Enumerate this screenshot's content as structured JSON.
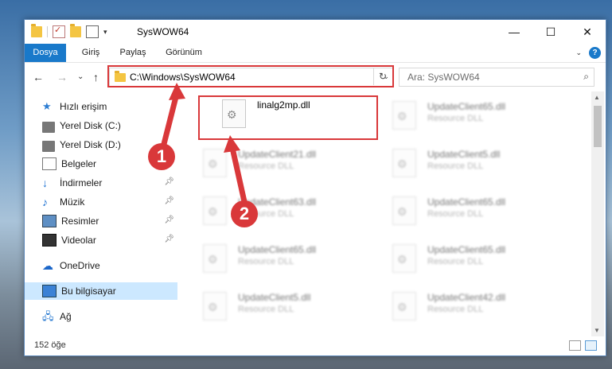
{
  "window": {
    "title": "SysWOW64"
  },
  "window_controls": {
    "minimize": "—",
    "maximize": "☐",
    "close": "✕"
  },
  "ribbon": {
    "tabs": [
      "Dosya",
      "Giriş",
      "Paylaş",
      "Görünüm"
    ],
    "help": "?"
  },
  "navigation": {
    "back": "←",
    "forward": "→",
    "recent": "⌄",
    "up": "↑",
    "address": "C:\\Windows\\SysWOW64",
    "refresh": "↻",
    "search_placeholder": "Ara: SysWOW64"
  },
  "sidebar": {
    "items": [
      {
        "label": "Hızlı erişim",
        "icon": "star-icon"
      },
      {
        "label": "Yerel Disk (C:)",
        "icon": "drive-icon"
      },
      {
        "label": "Yerel Disk (D:)",
        "icon": "drive-icon"
      },
      {
        "label": "Belgeler",
        "icon": "document-icon"
      },
      {
        "label": "İndirmeler",
        "icon": "download-icon"
      },
      {
        "label": "Müzik",
        "icon": "music-icon"
      },
      {
        "label": "Resimler",
        "icon": "pictures-icon"
      },
      {
        "label": "Videolar",
        "icon": "videos-icon"
      },
      {
        "label": "OneDrive",
        "icon": "cloud-icon"
      },
      {
        "label": "Bu bilgisayar",
        "icon": "computer-icon"
      },
      {
        "label": "Ağ",
        "icon": "network-icon"
      }
    ]
  },
  "files": {
    "highlighted": {
      "name": "linalg2mp.dll"
    },
    "resource_type": "Resource DLL",
    "left_column": [
      "UpdateClient21.dll",
      "UpdateClient63.dll",
      "UpdateClient65.dll",
      "UpdateClient5.dll"
    ],
    "right_column": [
      "UpdateClient65.dll",
      "UpdateClient5.dll",
      "UpdateClient65.dll",
      "UpdateClient65.dll",
      "UpdateClient42.dll"
    ]
  },
  "status": {
    "count": "152 öğe"
  },
  "annotations": {
    "marker1": "1",
    "marker2": "2"
  },
  "colors": {
    "accent": "#1979ca",
    "highlight": "#d9383a",
    "selection": "#cce8ff"
  }
}
